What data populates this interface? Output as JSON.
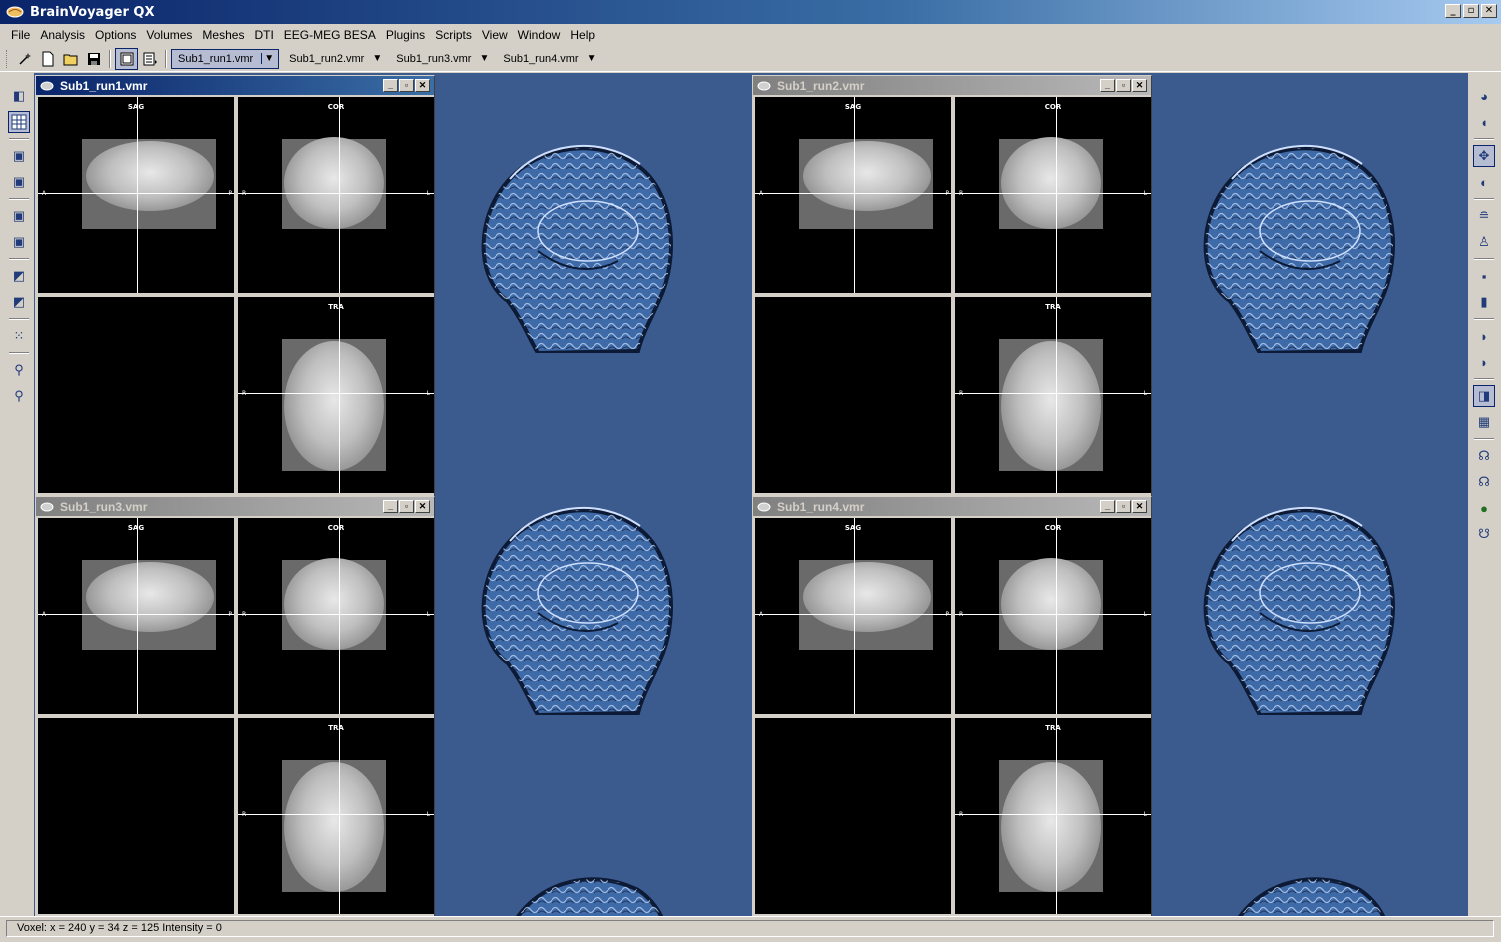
{
  "app": {
    "title": "BrainVoyager QX",
    "window_controls": [
      "_",
      "▫",
      "✕"
    ]
  },
  "menu": [
    "File",
    "Analysis",
    "Options",
    "Volumes",
    "Meshes",
    "DTI",
    "EEG-MEG BESA",
    "Plugins",
    "Scripts",
    "View",
    "Window",
    "Help"
  ],
  "toolbar": {
    "doc_tabs": [
      "Sub1_run1.vmr",
      "Sub1_run2.vmr",
      "Sub1_run3.vmr",
      "Sub1_run4.vmr"
    ],
    "active_tab": "Sub1_run1.vmr"
  },
  "windows": [
    {
      "title": "Sub1_run1.vmr",
      "active": true
    },
    {
      "title": "Sub1_run2.vmr",
      "active": false
    },
    {
      "title": "Sub1_run3.vmr",
      "active": false
    },
    {
      "title": "Sub1_run4.vmr",
      "active": false
    }
  ],
  "panes": {
    "sag": "SAG",
    "cor": "COR",
    "tra": "TRA",
    "orient_a": "A",
    "orient_p": "P",
    "orient_r": "R",
    "orient_l": "L"
  },
  "status": {
    "text": "Voxel:  x = 240 y = 34 z = 125  Intensity = 0"
  },
  "colors": {
    "mdi_background": "#3b5b8f",
    "title_active": "#0a246a",
    "title_inactive": "#808080"
  }
}
